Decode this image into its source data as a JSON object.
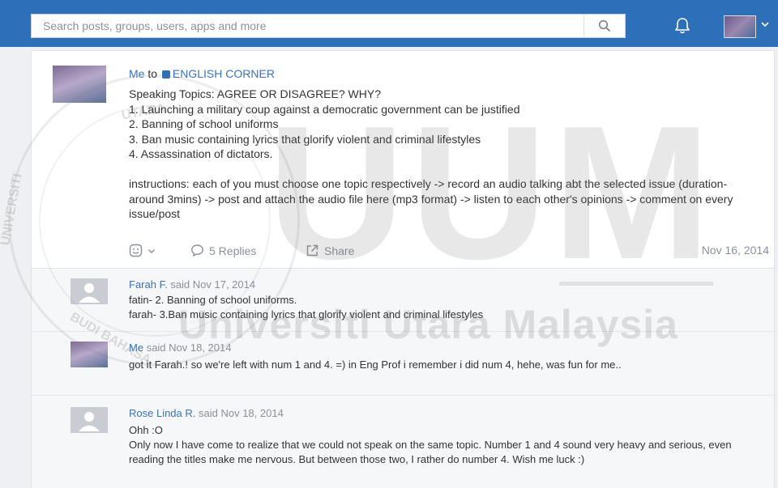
{
  "search": {
    "placeholder": "Search posts, groups, users, apps and more"
  },
  "icons": {
    "search": "search-icon",
    "bell": "bell-icon",
    "chevron": "chevron-down-icon",
    "emoji": "smile-icon",
    "replies": "speech-bubble-icon",
    "share": "share-icon",
    "default_avatar": "user-silhouette-icon"
  },
  "colors": {
    "header": "#2d6fb8",
    "link": "#3b73b9",
    "muted": "#8a9099"
  },
  "post": {
    "author": "Me",
    "to_word": "to",
    "group": "ENGLISH CORNER",
    "title": "Speaking Topics: AGREE OR DISAGREE? WHY?",
    "topics": [
      "1. Launching a military coup against a democratic government can be justified",
      "2. Banning of school uniforms",
      "3. Ban music containing lyrics that glorify violent and criminal lifestyles",
      "4. Assassination of dictators."
    ],
    "instructions": "instructions: each of you must choose one topic respectively -> record an audio talking abt the selected issue (duration- around 3mins) -> post and attach the audio file here (mp3 format) -> listen to each other's opinions -> comment on every issue/post",
    "replies_label": "5 Replies",
    "share_label": "Share",
    "date": "Nov 16, 2014"
  },
  "replies": [
    {
      "author": "Farah F.",
      "said": "said Nov 17, 2014",
      "lines": [
        "fatin- 2. Banning of school uniforms.",
        "farah- 3.Ban music containing lyrics that glorify violent and criminal lifestyles"
      ]
    },
    {
      "author": "Me",
      "said": "said Nov 18, 2014",
      "lines": [
        "got it Farah.! so we're left with num 1 and 4. =) in Eng Prof i remember i did num 4, hehe, was fun for me.."
      ]
    },
    {
      "author": "Rose Linda R.",
      "said": "said Nov 18, 2014",
      "lines": [
        "Ohh :O",
        "Only now I have come to realize that we could not speak on the same topic. Number 1 and 4 sound very heavy and serious, even reading the titles make me nervous. But between those two, I rather do number 4. Wish me luck :)"
      ]
    }
  ],
  "watermark": {
    "big": "UUM",
    "sub": "Universiti Utara Malaysia",
    "arc_top": "UTARA",
    "arc_left": "UNIVERSITI",
    "arc_bottom": "BUDI BAHASA"
  }
}
